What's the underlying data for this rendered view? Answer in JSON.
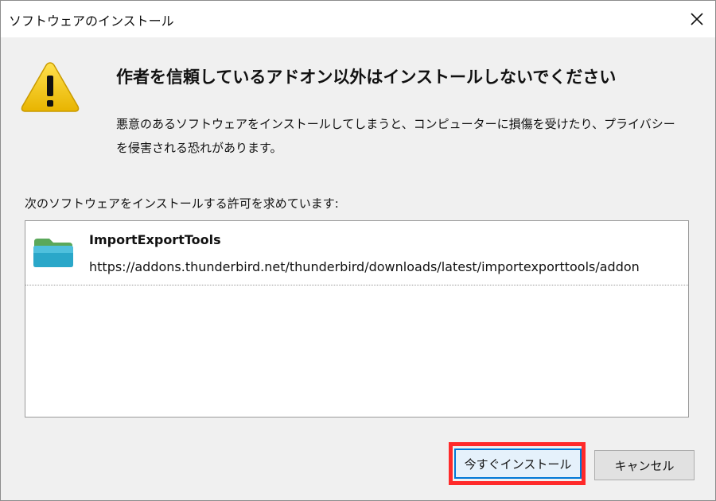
{
  "window": {
    "title": "ソフトウェアのインストール"
  },
  "warning": {
    "heading": "作者を信頼しているアドオン以外はインストールしないでください",
    "description_line1": "悪意のあるソフトウェアをインストールしてしまうと、コンピューターに損傷を受けたり、プライバシー",
    "description_line2": "を侵害される恐れがあります。"
  },
  "request": {
    "label": "次のソフトウェアをインストールする許可を求めています:"
  },
  "addons": [
    {
      "name": "ImportExportTools",
      "url": "https://addons.thunderbird.net/thunderbird/downloads/latest/importexporttools/addon"
    }
  ],
  "buttons": {
    "install": "今すぐインストール",
    "cancel": "キャンセル"
  },
  "colors": {
    "highlight_border": "#ff2a2a",
    "warning_yellow": "#f5c400"
  }
}
